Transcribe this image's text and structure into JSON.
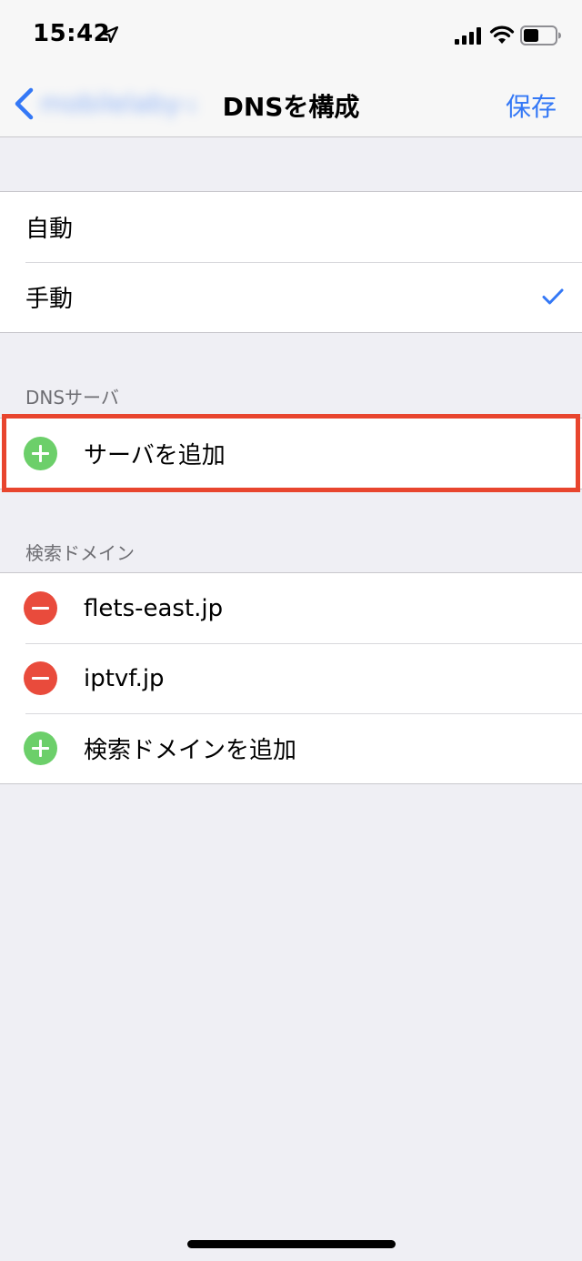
{
  "status_bar": {
    "time": "15:42",
    "icons": [
      "location-arrow-icon",
      "cellular-signal-icon",
      "wifi-icon",
      "battery-icon"
    ]
  },
  "nav": {
    "back_label": "mobilelaby-a",
    "title": "DNSを構成",
    "save_label": "保存"
  },
  "dns_mode": {
    "options": [
      {
        "label": "自動",
        "selected": false
      },
      {
        "label": "手動",
        "selected": true
      }
    ]
  },
  "dns_servers": {
    "header": "DNSサーバ",
    "add_label": "サーバを追加"
  },
  "search_domains": {
    "header": "検索ドメイン",
    "items": [
      "flets-east.jp",
      "iptvf.jp"
    ],
    "add_label": "検索ドメインを追加"
  },
  "colors": {
    "accent": "#3478f6",
    "add_green": "#6ccf6a",
    "remove_red": "#e94b3c",
    "highlight": "#e8452e"
  }
}
